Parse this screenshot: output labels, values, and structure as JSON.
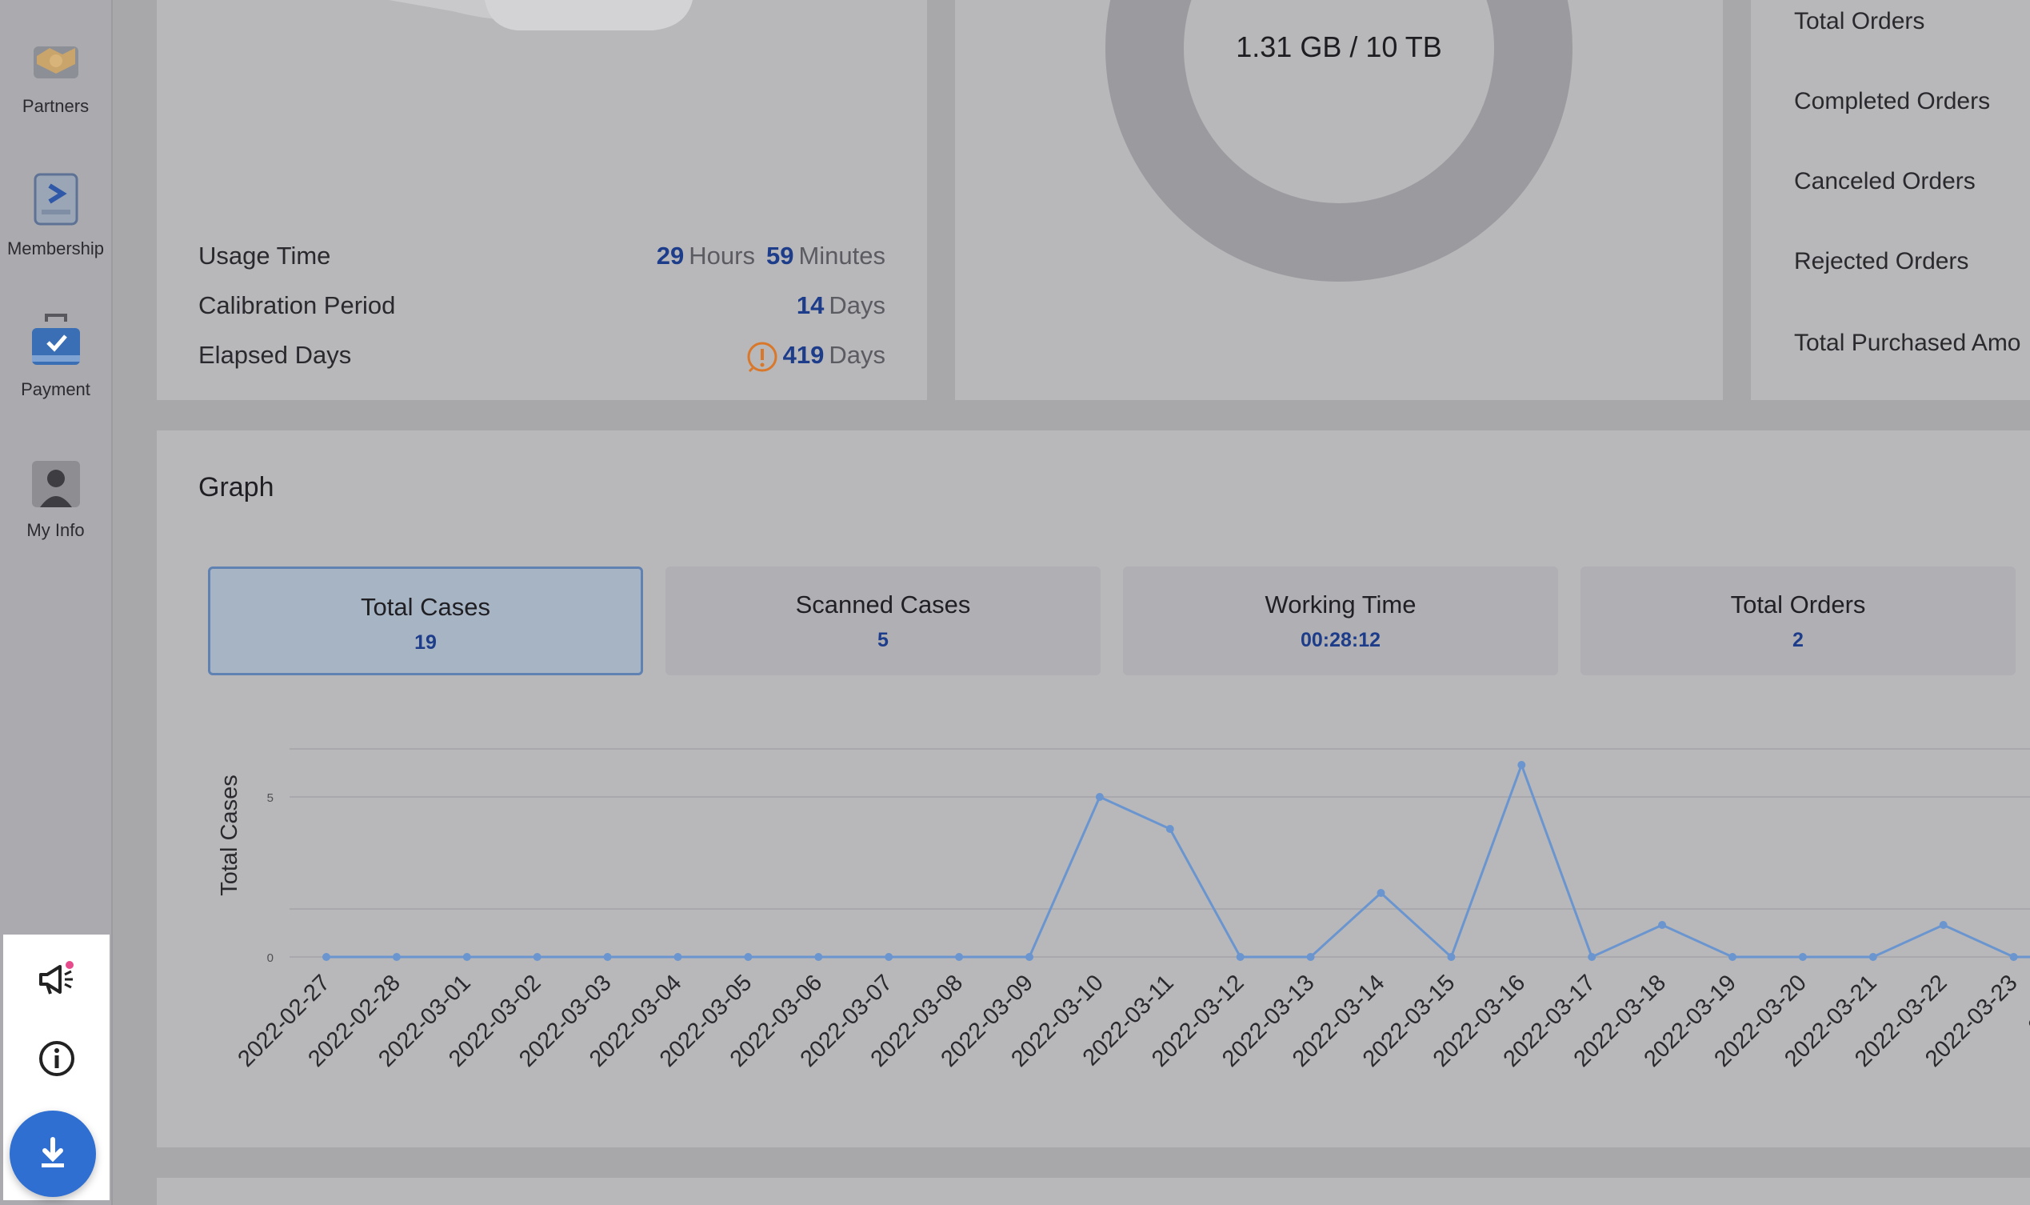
{
  "sidebar": {
    "items": [
      {
        "label": "Partners",
        "icon": "handshake-icon"
      },
      {
        "label": "Membership",
        "icon": "membership-icon"
      },
      {
        "label": "Payment",
        "icon": "payment-icon"
      },
      {
        "label": "My Info",
        "icon": "person-icon"
      }
    ],
    "utilities": [
      {
        "icon": "megaphone-icon"
      },
      {
        "icon": "info-icon"
      },
      {
        "icon": "download-icon"
      }
    ]
  },
  "device": {
    "rows": [
      {
        "label": "Usage Time",
        "v1": "29",
        "u1": "Hours",
        "v2": "59",
        "u2": "Minutes"
      },
      {
        "label": "Calibration Period",
        "v1": "14",
        "u1": "Days"
      },
      {
        "label": "Elapsed Days",
        "v1": "419",
        "u1": "Days",
        "warning": true
      }
    ]
  },
  "storage": {
    "text": "1.31 GB / 10 TB"
  },
  "orders": {
    "labels": [
      "Total Orders",
      "Completed Orders",
      "Canceled Orders",
      "Rejected Orders",
      "Total Purchased Amo"
    ]
  },
  "graph": {
    "title": "Graph",
    "tabs": [
      {
        "label": "Total Cases",
        "value": "19",
        "active": true
      },
      {
        "label": "Scanned Cases",
        "value": "5"
      },
      {
        "label": "Working Time",
        "value": "00:28:12"
      },
      {
        "label": "Total Orders",
        "value": "2"
      }
    ]
  },
  "colors": {
    "line": "#6a95cf",
    "accent": "#2f6fd2",
    "number": "#1d3d8a",
    "warning": "#d9782a"
  },
  "chart_data": {
    "type": "line",
    "ylabel": "Total Cases",
    "ylim": [
      0,
      6
    ],
    "yticks": [
      0,
      5
    ],
    "x": [
      "2022-02-27",
      "2022-02-28",
      "2022-03-01",
      "2022-03-02",
      "2022-03-03",
      "2022-03-04",
      "2022-03-05",
      "2022-03-06",
      "2022-03-07",
      "2022-03-08",
      "2022-03-09",
      "2022-03-10",
      "2022-03-11",
      "2022-03-12",
      "2022-03-13",
      "2022-03-14",
      "2022-03-15",
      "2022-03-16",
      "2022-03-17",
      "2022-03-18",
      "2022-03-19",
      "2022-03-20",
      "2022-03-21",
      "2022-03-22",
      "2022-03-23",
      "2022-0"
    ],
    "series": [
      {
        "values": [
          0,
          0,
          0,
          0,
          0,
          0,
          0,
          0,
          0,
          0,
          0,
          5,
          4,
          0,
          0,
          2,
          0,
          6,
          0,
          1,
          0,
          0,
          0,
          1,
          0,
          0
        ]
      }
    ],
    "grid": true
  }
}
